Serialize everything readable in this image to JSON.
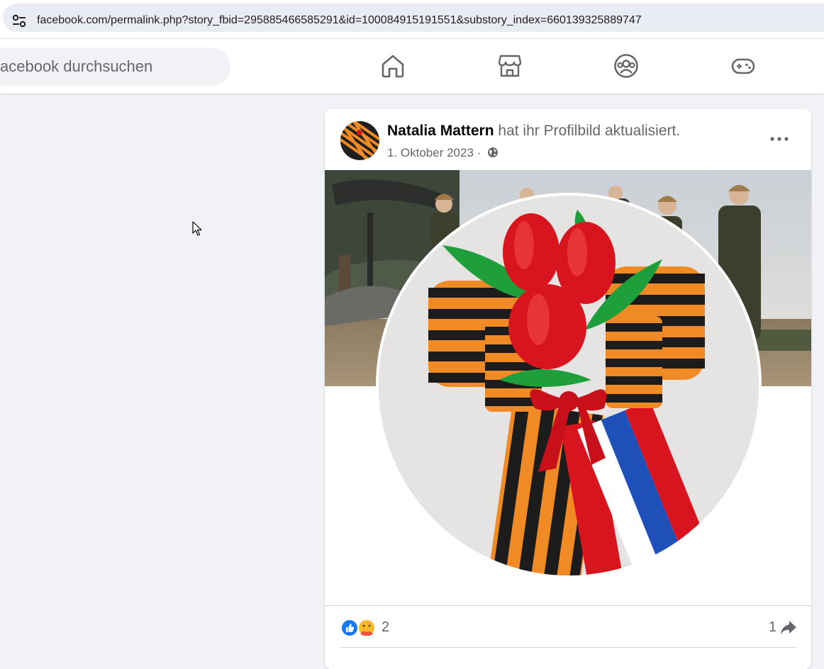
{
  "browser": {
    "url": "facebook.com/permalink.php?story_fbid=295885466585291&id=100084915191551&substory_index=660139325889747"
  },
  "topnav": {
    "search_placeholder": "acebook durchsuchen",
    "icons": [
      "home-icon",
      "marketplace-icon",
      "groups-icon",
      "gaming-icon"
    ]
  },
  "post": {
    "author": "Natalia Mattern",
    "action": " hat ihr Profilbild aktualisiert.",
    "date": "1. Oktober 2023",
    "separator": " · ",
    "visibility_icon": "globe-icon",
    "reaction_count": "2",
    "share_count": "1",
    "reactions": [
      "like-icon",
      "care-icon"
    ]
  },
  "colors": {
    "accent": "#1877f2",
    "ribbon_orange": "#f08a24",
    "ribbon_black": "#1c1c1c",
    "tulip_red": "#d8141e"
  }
}
